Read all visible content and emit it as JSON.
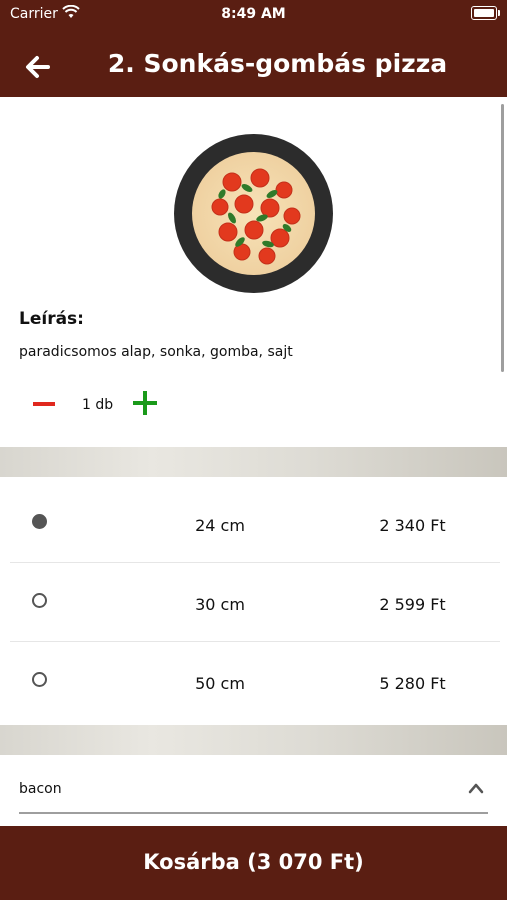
{
  "status_bar": {
    "carrier": "Carrier",
    "time": "8:49 AM"
  },
  "header": {
    "title": "2. Sonkás-gombás pizza",
    "back_icon": "arrow-left-icon"
  },
  "product": {
    "image_icon": "pizza-image",
    "description_title": "Leírás:",
    "description": "paradicsomos alap, sonka, gomba, sajt",
    "quantity": "1 db"
  },
  "sizes": [
    {
      "label": "24 cm",
      "price": "2 340 Ft",
      "selected": true
    },
    {
      "label": "30 cm",
      "price": "2 599 Ft",
      "selected": false
    },
    {
      "label": "50 cm",
      "price": "5 280 Ft",
      "selected": false
    }
  ],
  "topping_select": {
    "value": "bacon"
  },
  "cart": {
    "label": "Kosárba (3 070 Ft)"
  },
  "colors": {
    "brand": "#5a1e12",
    "minus": "#e0281e",
    "plus": "#1a9a1a"
  }
}
